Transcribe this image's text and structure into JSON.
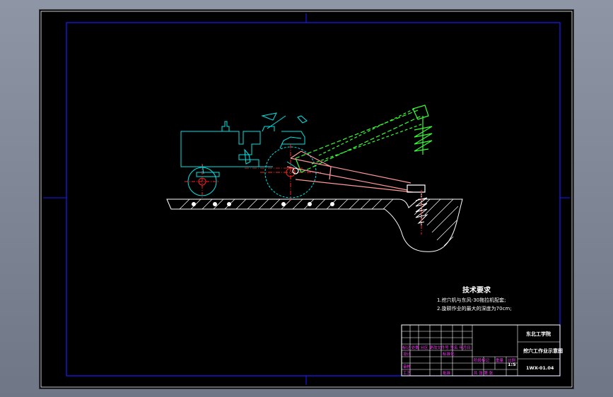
{
  "drawing": {
    "notes_title": "技术要求",
    "notes": [
      "1.挖穴机与东风-30拖拉机配套;",
      "2.旋耕作业的最大的深度为70cm;"
    ],
    "title_block": {
      "school": "东北工学院",
      "drawing_name": "挖穴工作业示意图",
      "drawing_number": "1WX-01.04",
      "scale": "1:5",
      "revision_header": "标记 处数 分区 更改文件号 签名 年月日",
      "designer_label": "设计",
      "standardization_label": "标准化",
      "review_label": "审核",
      "process_label": "工艺",
      "approve_label": "批准",
      "stage_label": "阶段标记",
      "weight_label": "重量",
      "ratio_label": "比例",
      "sheets_label": "共 张 第 张"
    },
    "colors": {
      "frame": "#1a1aff",
      "machine": "#00e5e5",
      "boom": "#33ff33",
      "link": "#ff9999",
      "ground": "#ffffff",
      "centerline": "#ff2222",
      "titleblock_text": "#ff33ff"
    }
  }
}
